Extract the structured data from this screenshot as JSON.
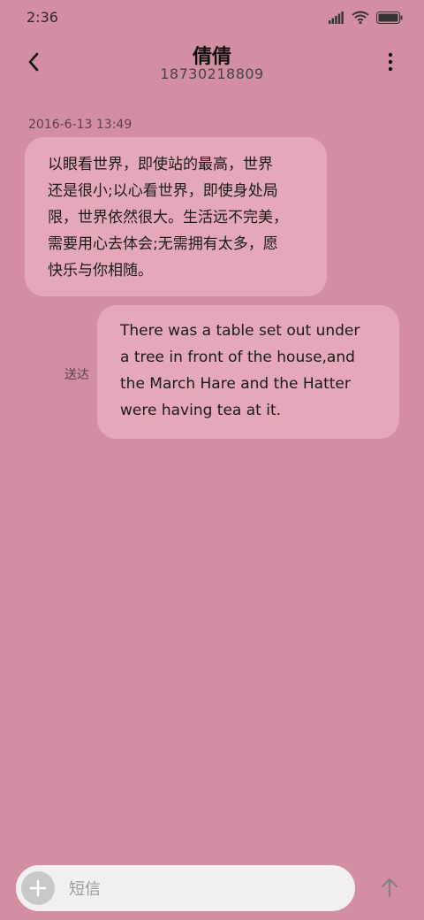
{
  "status_bar": {
    "time": "2:36",
    "icons": [
      "signal-icon",
      "wifi-icon",
      "battery-icon"
    ]
  },
  "header": {
    "contact_name": "倩倩",
    "phone_number": "18730218809",
    "back_icon": "back-arrow-icon",
    "menu_icon": "more-vertical-icon"
  },
  "conversation": {
    "timestamp": "2016-6-13 13:49",
    "incoming": {
      "lines": [
        "以眼看世界，即使站的最高，世界",
        "还是很小;以心看世界，即使身处局",
        "限，世界依然很大。生活远不完美，",
        "需要用心去体会;无需拥有太多，愿",
        "快乐与你相随。"
      ]
    },
    "outgoing": {
      "lines": [
        "There was a table set out under",
        "a tree in front of the house,and",
        "the March Hare and the Hatter",
        "were having tea at it."
      ],
      "status": "送达"
    }
  },
  "composer": {
    "placeholder": "短信",
    "add_icon": "plus-icon",
    "send_icon": "arrow-up-icon"
  },
  "colors": {
    "background": "#d38f9f",
    "bubble": "#e5a8b7",
    "composer": "#f2eff0"
  }
}
